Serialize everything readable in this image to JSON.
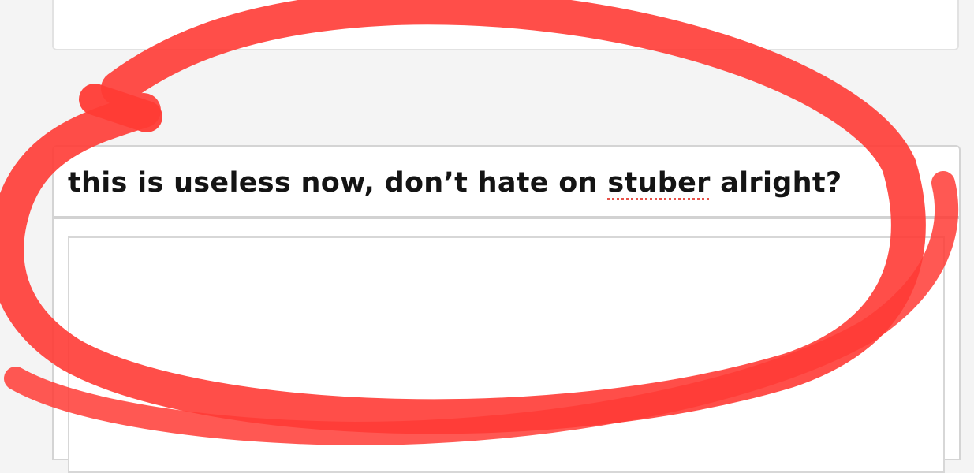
{
  "post_title": {
    "text_before": "this is useless now, don’t hate on ",
    "misspelled_word": "stuber",
    "text_after": " alright?"
  },
  "post_body": {
    "value": ""
  },
  "annotation": {
    "shape": "hand-drawn ellipse",
    "color": "#ff3b35"
  },
  "colors": {
    "page_background": "#f4f4f4",
    "card_background": "#ffffff",
    "card_border": "#d4d4d4",
    "spellcheck_underline": "#e8524a"
  }
}
